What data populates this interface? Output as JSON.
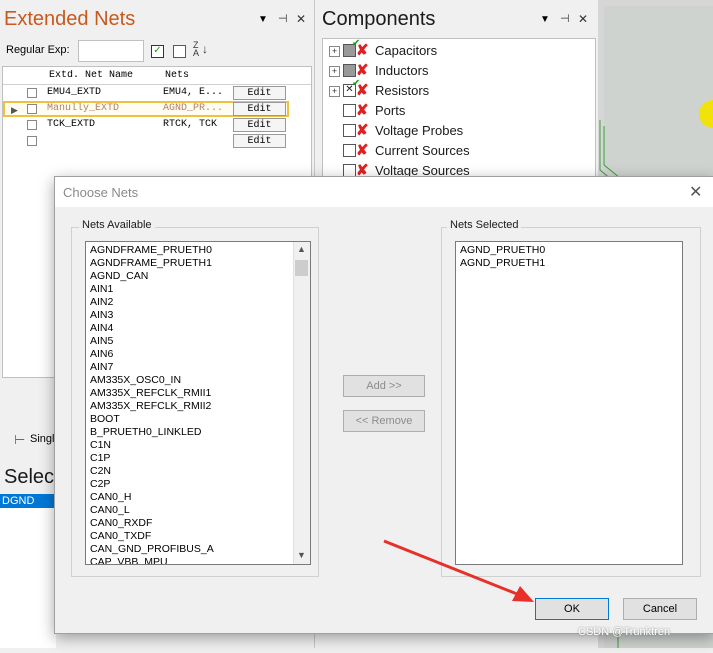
{
  "extended_nets": {
    "title": "Extended Nets",
    "regex_label": "Regular Exp:",
    "regex_value": "",
    "sort_icon_text": "Z↓A",
    "columns": [
      "Extd. Net Name",
      "Nets"
    ],
    "rows": [
      {
        "name": "EMU4_EXTD",
        "nets": "EMU4, E...",
        "edit": "Edit"
      },
      {
        "name": "Manully_EXTD",
        "nets": "AGND_PR...",
        "edit": "Edit"
      },
      {
        "name": "TCK_EXTD",
        "nets": "RTCK, TCK",
        "edit": "Edit"
      },
      {
        "name": "",
        "nets": "",
        "edit": "Edit"
      }
    ],
    "bottom_tab": "Singl",
    "select_label": "Select",
    "select_item": "DGND"
  },
  "components": {
    "title": "Components",
    "items": [
      {
        "label": "Capacitors"
      },
      {
        "label": "Inductors"
      },
      {
        "label": "Resistors"
      },
      {
        "label": "Ports"
      },
      {
        "label": "Voltage Probes"
      },
      {
        "label": "Current Sources"
      },
      {
        "label": "Voltage Sources"
      }
    ]
  },
  "dialog": {
    "title": "Choose Nets",
    "nets_available_label": "Nets Available",
    "nets_selected_label": "Nets Selected",
    "nets_available": [
      "AGNDFRAME_PRUETH0",
      "AGNDFRAME_PRUETH1",
      "AGND_CAN",
      "AIN1",
      "AIN2",
      "AIN3",
      "AIN4",
      "AIN5",
      "AIN6",
      "AIN7",
      "AM335X_OSC0_IN",
      "AM335X_REFCLK_RMII1",
      "AM335X_REFCLK_RMII2",
      "BOOT",
      "B_PRUETH0_LINKLED",
      "C1N",
      "C1P",
      "C2N",
      "C2P",
      "CAN0_H",
      "CAN0_L",
      "CAN0_RXDF",
      "CAN0_TXDF",
      "CAN_GND_PROFIBUS_A",
      "CAP_VBB_MPU"
    ],
    "nets_selected": [
      "AGND_PRUETH0",
      "AGND_PRUETH1"
    ],
    "add_label": "Add >>",
    "remove_label": "<< Remove",
    "ok_label": "OK",
    "cancel_label": "Cancel"
  },
  "watermark": "CSDN @Trunktren",
  "colors": {
    "accent_title": "#c65a1f",
    "arrow": "#e8302a",
    "selected_row_border": "#f0c040"
  }
}
